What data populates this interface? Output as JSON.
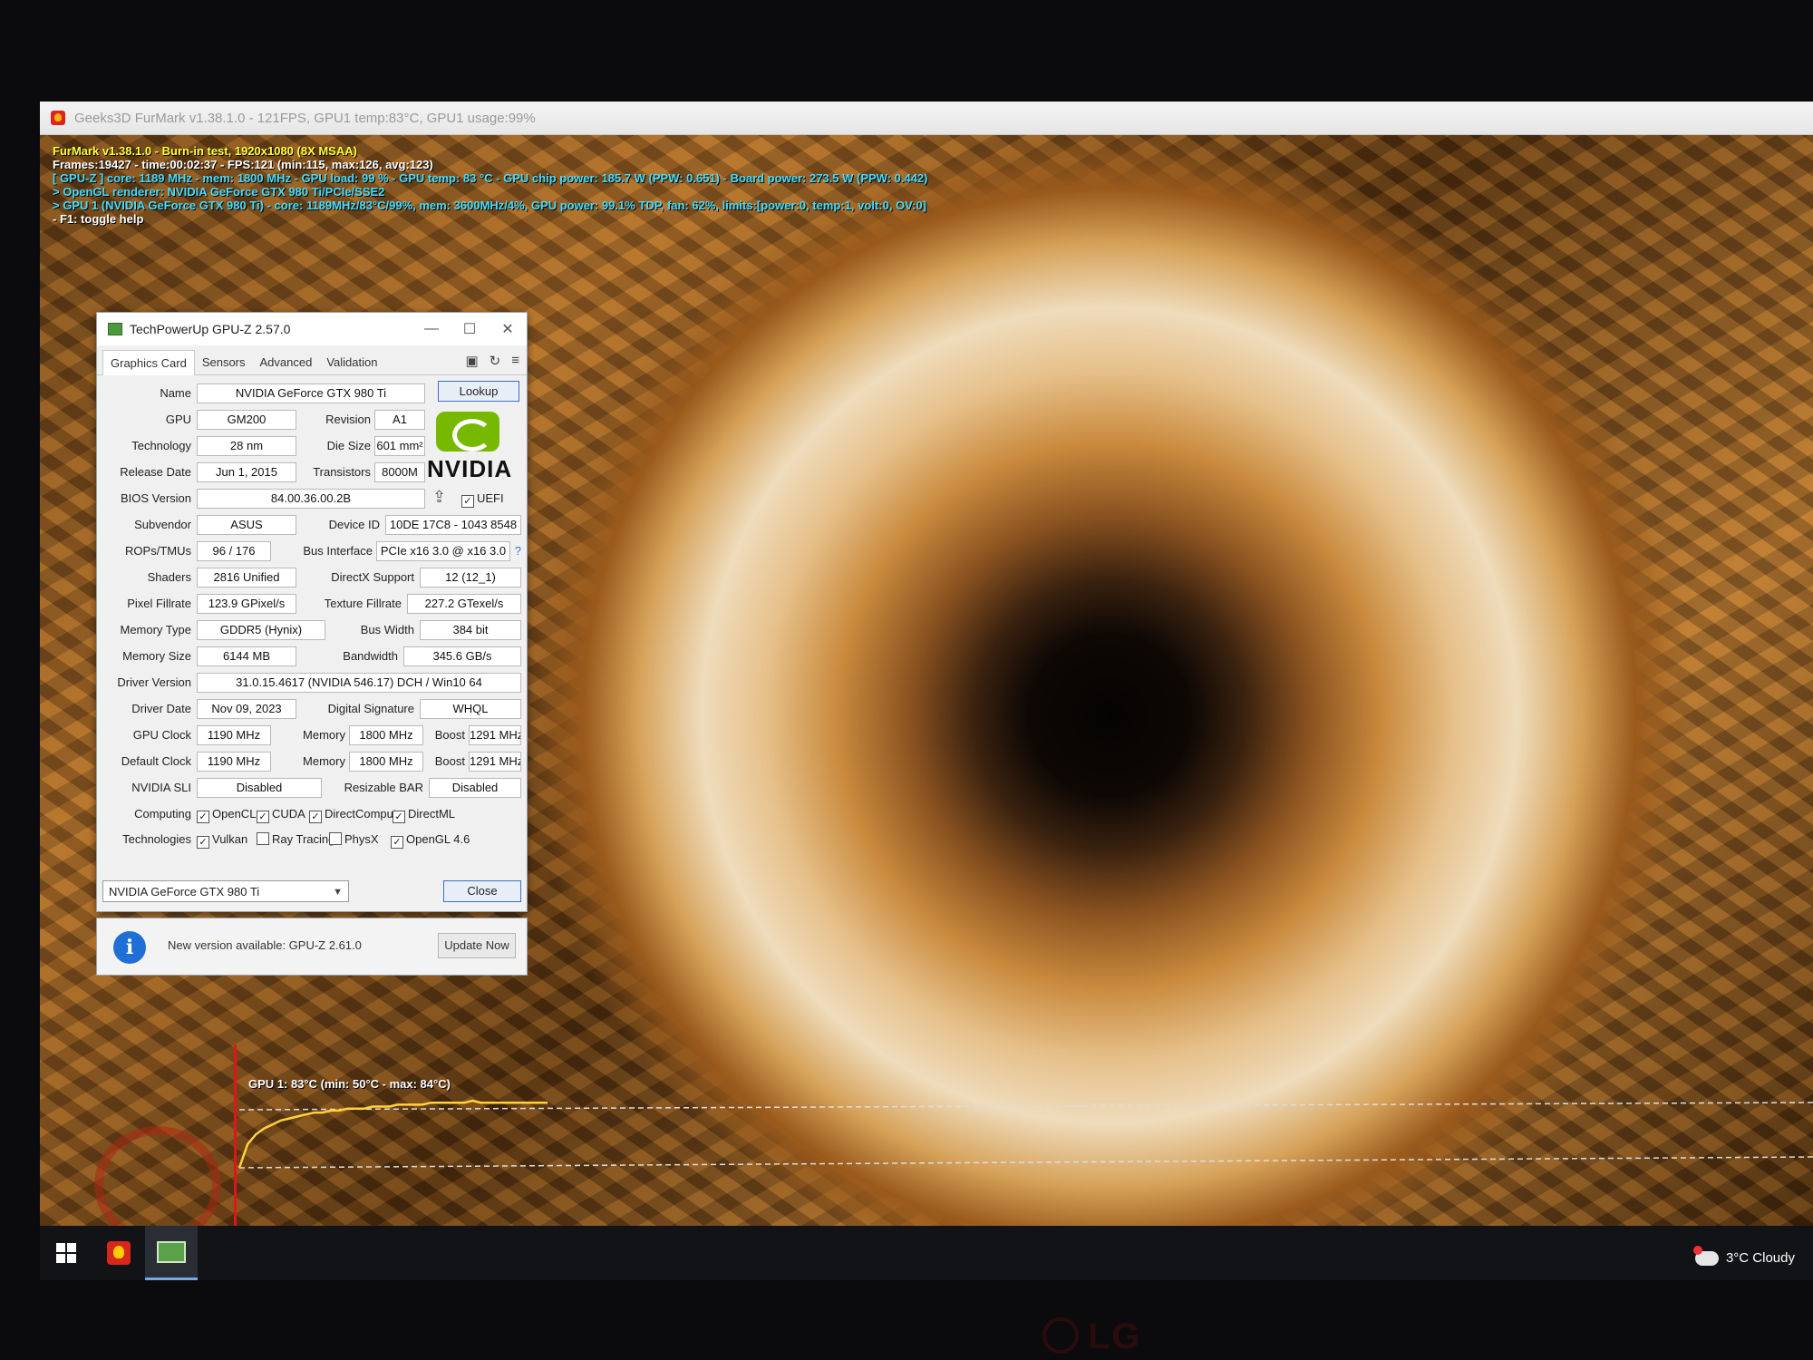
{
  "furmark": {
    "window_title": "Geeks3D FurMark v1.38.1.0 - 121FPS, GPU1 temp:83°C, GPU1 usage:99%",
    "overlay": {
      "line1": "FurMark v1.38.1.0 - Burn-in test, 1920x1080 (8X MSAA)",
      "line2": "Frames:19427 - time:00:02:37 - FPS:121 (min:115, max:126, avg:123)",
      "line3": "[ GPU-Z ] core: 1189 MHz - mem: 1800 MHz - GPU load: 99 % - GPU temp: 83 °C - GPU chip power: 185.7 W (PPW: 0.651) - Board power: 273.5 W (PPW: 0.442)",
      "line4": "> OpenGL renderer: NVIDIA GeForce GTX 980 Ti/PCIe/SSE2",
      "line5": "> GPU 1 (NVIDIA GeForce GTX 980 Ti) - core: 1189MHz/83°C/99%, mem: 3600MHz/4%, GPU power: 99.1% TDP, fan: 62%, limits:[power:0, temp:1, volt:0, OV:0]",
      "line6": "- F1: toggle help"
    },
    "graph": {
      "title": "GPU 1: 83°C (min: 50°C - max: 84°C)",
      "line_color": "#ffd23a",
      "temps": [
        50,
        62,
        67,
        70,
        72,
        74,
        75,
        76,
        77,
        78,
        78,
        79,
        79,
        80,
        80,
        80,
        81,
        81,
        81,
        82,
        82,
        82,
        82,
        83,
        83,
        83,
        83,
        83,
        84,
        83,
        83,
        83,
        83,
        83,
        83,
        83,
        83,
        83
      ]
    }
  },
  "gpuz": {
    "title": "TechPowerUp GPU-Z 2.57.0",
    "tabs": [
      "Graphics Card",
      "Sensors",
      "Advanced",
      "Validation"
    ],
    "fields": {
      "name_label": "Name",
      "name": "NVIDIA GeForce GTX 980 Ti",
      "lookup": "Lookup",
      "gpu_label": "GPU",
      "gpu": "GM200",
      "revision_label": "Revision",
      "revision": "A1",
      "technology_label": "Technology",
      "technology": "28 nm",
      "die_size_label": "Die Size",
      "die_size": "601 mm²",
      "release_label": "Release Date",
      "release": "Jun 1, 2015",
      "transistors_label": "Transistors",
      "transistors": "8000M",
      "bios_label": "BIOS Version",
      "bios": "84.00.36.00.2B",
      "uefi": "UEFI",
      "subvendor_label": "Subvendor",
      "subvendor": "ASUS",
      "device_id_label": "Device ID",
      "device_id": "10DE 17C8 - 1043 8548",
      "rops_label": "ROPs/TMUs",
      "rops": "96 / 176",
      "bus_label": "Bus Interface",
      "bus": "PCIe x16 3.0 @ x16 3.0",
      "help": "?",
      "shaders_label": "Shaders",
      "shaders": "2816 Unified",
      "directx_label": "DirectX Support",
      "directx": "12 (12_1)",
      "pixel_label": "Pixel Fillrate",
      "pixel": "123.9 GPixel/s",
      "texture_label": "Texture Fillrate",
      "texture": "227.2 GTexel/s",
      "memtype_label": "Memory Type",
      "memtype": "GDDR5 (Hynix)",
      "buswidth_label": "Bus Width",
      "buswidth": "384 bit",
      "memsize_label": "Memory Size",
      "memsize": "6144 MB",
      "bandwidth_label": "Bandwidth",
      "bandwidth": "345.6 GB/s",
      "driver_label": "Driver Version",
      "driver": "31.0.15.4617 (NVIDIA 546.17) DCH / Win10 64",
      "driver_date_label": "Driver Date",
      "driver_date": "Nov 09, 2023",
      "signature_label": "Digital Signature",
      "signature": "WHQL",
      "gpu_clock_label": "GPU Clock",
      "gpu_clock": "1190 MHz",
      "memory_label": "Memory",
      "mem_clock": "1800 MHz",
      "boost_label": "Boost",
      "boost": "1291 MHz",
      "default_clock_label": "Default Clock",
      "default_clock": "1190 MHz",
      "default_mem": "1800 MHz",
      "default_boost": "1291 MHz",
      "sli_label": "NVIDIA SLI",
      "sli": "Disabled",
      "rebar_label": "Resizable BAR",
      "rebar": "Disabled",
      "computing_label": "Computing",
      "technologies_label": "Technologies"
    },
    "computing": [
      {
        "label": "OpenCL",
        "checked": true
      },
      {
        "label": "CUDA",
        "checked": true
      },
      {
        "label": "DirectCompute",
        "checked": true
      },
      {
        "label": "DirectML",
        "checked": true
      }
    ],
    "technologies": [
      {
        "label": "Vulkan",
        "checked": true
      },
      {
        "label": "Ray Tracing",
        "checked": false
      },
      {
        "label": "PhysX",
        "checked": false
      },
      {
        "label": "OpenGL 4.6",
        "checked": true
      }
    ],
    "vendor_logo": "NVIDIA",
    "selected_gpu": "NVIDIA GeForce GTX 980 Ti",
    "close": "Close",
    "notice": {
      "text": "New version available: GPU-Z 2.61.0",
      "button": "Update Now"
    }
  },
  "taskbar": {
    "weather": "3°C Cloudy"
  },
  "monitor": {
    "brand": "LG"
  },
  "colors": {
    "nvidia_green": "#76b900",
    "overlay_yellow": "#ffff3a",
    "overlay_cyan": "#44ddff"
  }
}
